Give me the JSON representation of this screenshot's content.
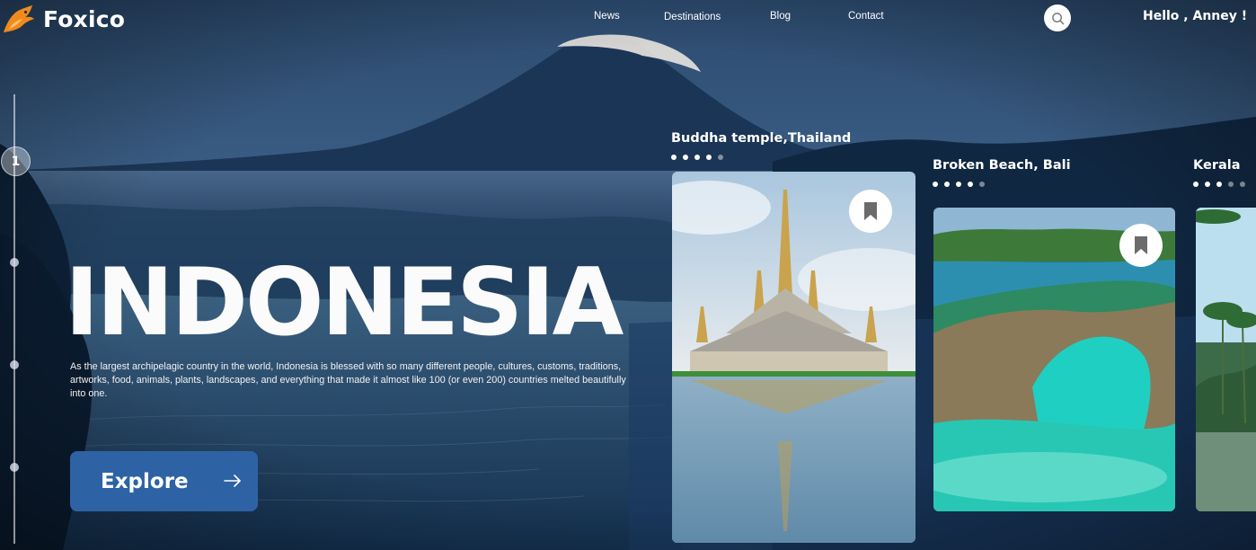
{
  "brand": {
    "name": "Foxico"
  },
  "nav": {
    "items": [
      {
        "label": "News"
      },
      {
        "label": "Destinations"
      },
      {
        "label": "Blog"
      },
      {
        "label": "Contact"
      }
    ]
  },
  "search": {
    "icon": "search-icon"
  },
  "user": {
    "greeting": "Hello , Anney !"
  },
  "pager": {
    "active_label": "1",
    "total": 4
  },
  "hero": {
    "title": "INDONESIA",
    "description": "As the largest archipelagic country in the world, Indonesia is blessed with so many different people, cultures, customs, traditions, artworks, food, animals, plants, landscapes, and everything that made it almost like 100 (or even 200) countries melted beautifully into one.",
    "cta_label": "Explore",
    "cta_icon": "arrow-right-icon"
  },
  "destinations": [
    {
      "title": "Buddha temple,Thailand",
      "rating_filled": 4,
      "rating_total": 5,
      "icon": "bookmark-icon"
    },
    {
      "title": "Broken Beach, Bali",
      "rating_filled": 4,
      "rating_total": 5,
      "icon": "bookmark-icon"
    },
    {
      "title": "Kerala",
      "rating_filled": 3,
      "rating_total": 5
    }
  ],
  "colors": {
    "accent": "#2d63a5",
    "logo_orange": "#f08a1c",
    "text": "#ffffff"
  }
}
